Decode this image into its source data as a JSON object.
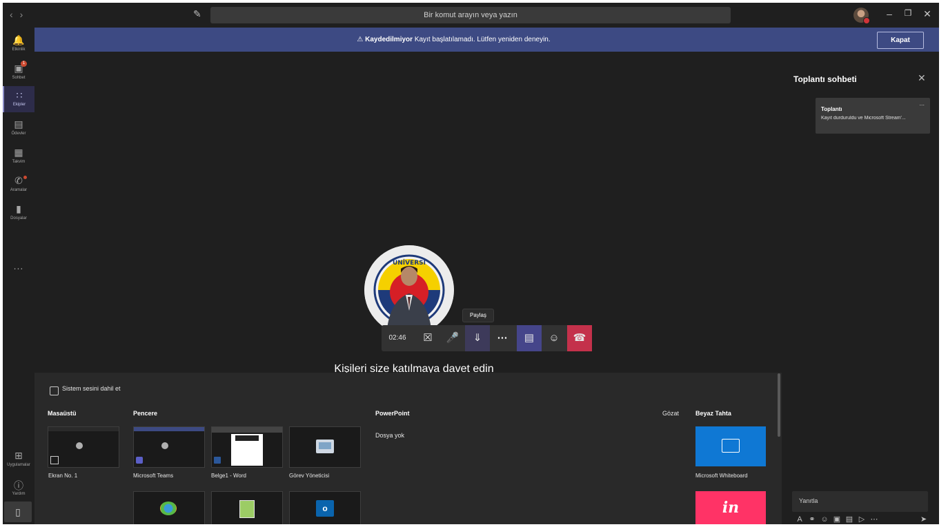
{
  "titlebar": {
    "search_placeholder": "Bir komut arayın veya yazın"
  },
  "rail": {
    "items": [
      {
        "label": "Etkinlik",
        "icon": "bell-icon"
      },
      {
        "label": "Sohbet",
        "icon": "chat-icon",
        "badge": "1"
      },
      {
        "label": "Ekipler",
        "icon": "teams-icon",
        "active": true
      },
      {
        "label": "Ödevler",
        "icon": "assignments-icon"
      },
      {
        "label": "Takvim",
        "icon": "calendar-icon"
      },
      {
        "label": "Aramalar",
        "icon": "calls-icon"
      },
      {
        "label": "Dosyalar",
        "icon": "files-icon"
      }
    ],
    "more": "...",
    "bottom": [
      {
        "label": "Uygulamalar",
        "icon": "apps-icon"
      },
      {
        "label": "Yardım",
        "icon": "help-icon"
      }
    ]
  },
  "banner": {
    "status": "Kaydedilmiyor",
    "message": "Kayıt başlatılamadı. Lütfen yeniden deneyin.",
    "close_label": "Kapat",
    "color": "#3d4a83"
  },
  "call": {
    "timer": "02:46",
    "tooltip": "Paylaş",
    "invite_text": "Kişileri size katılmaya davet edin",
    "hangup_color": "#c4314b",
    "avatar_ring_text": "FENERBAHÇE ÜNİVERSİTESİ"
  },
  "share_tray": {
    "include_sound_label": "Sistem sesini dahil et",
    "sections": {
      "desktop": "Masaüstü",
      "window": "Pencere",
      "powerpoint": "PowerPoint",
      "browse": "Gözat",
      "whiteboard": "Beyaz Tahta"
    },
    "desktop_items": [
      "Ekran No. 1"
    ],
    "window_items": [
      "Microsoft Teams",
      "Belge1 - Word",
      "Görev Yöneticisi"
    ],
    "powerpoint_empty": "Dosya yok",
    "whiteboard_items": [
      "Microsoft Whiteboard"
    ],
    "invision_text": "in"
  },
  "chat": {
    "title": "Toplantı sohbeti",
    "messages": [
      {
        "title": "Toplantı",
        "body": "Kayıt durduruldu ve Microsoft Stream'...",
        "more": "..."
      }
    ],
    "reply_placeholder": "Yanıtla"
  }
}
